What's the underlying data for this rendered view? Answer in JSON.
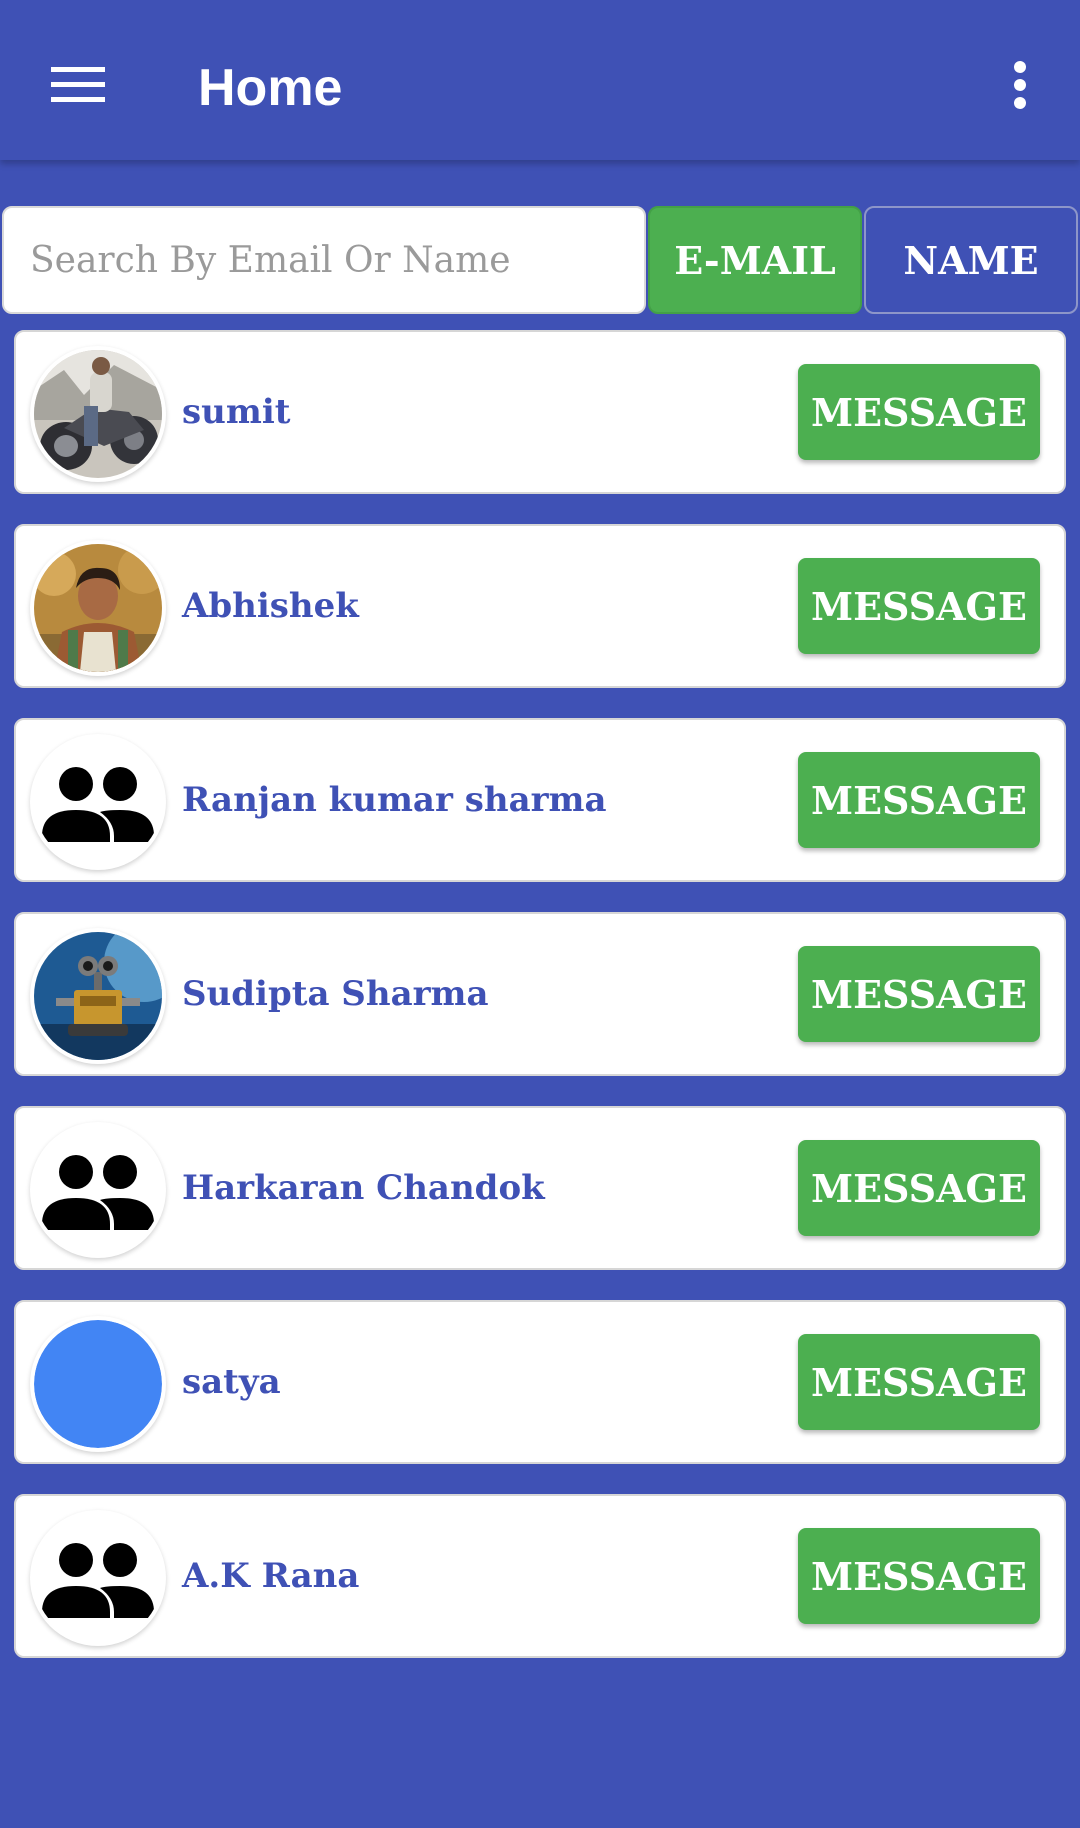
{
  "appbar": {
    "title": "Home",
    "menu_icon": "hamburger-menu-icon",
    "overflow_icon": "more-vert-icon"
  },
  "search": {
    "placeholder": "Search By Email Or Name",
    "value": "",
    "email_button_label": "E-MAIL",
    "name_button_label": "NAME"
  },
  "users": [
    {
      "name": "sumit",
      "avatar": "photo-motorbike",
      "action_label": "MESSAGE"
    },
    {
      "name": "Abhishek",
      "avatar": "photo-person",
      "action_label": "MESSAGE"
    },
    {
      "name": "Ranjan kumar sharma",
      "avatar": "group-icon",
      "action_label": "MESSAGE"
    },
    {
      "name": "Sudipta Sharma",
      "avatar": "photo-robot",
      "action_label": "MESSAGE"
    },
    {
      "name": "Harkaran Chandok",
      "avatar": "group-icon",
      "action_label": "MESSAGE"
    },
    {
      "name": "satya",
      "avatar": "blue-circle",
      "action_label": "MESSAGE"
    },
    {
      "name": "A.K Rana",
      "avatar": "group-icon",
      "action_label": "MESSAGE"
    }
  ],
  "colors": {
    "primary": "#3f51b5",
    "accent_green": "#4caf50",
    "name_text": "#3f51b5",
    "avatar_blue": "#4285f4"
  }
}
